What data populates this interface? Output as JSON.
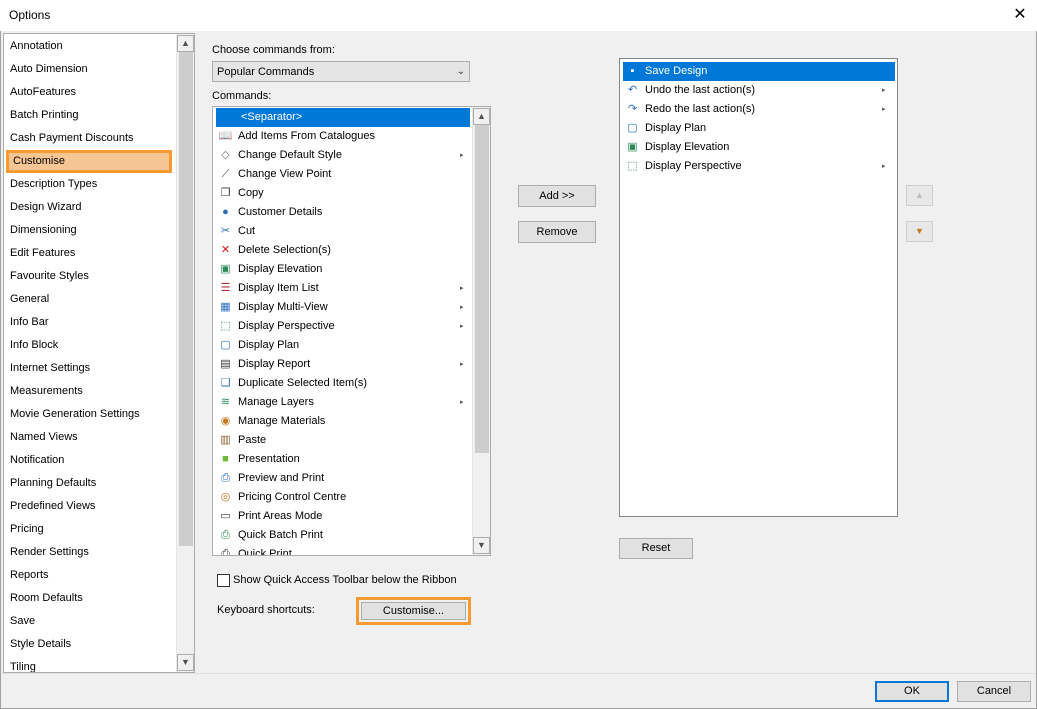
{
  "window": {
    "title": "Options",
    "close_glyph": "✕"
  },
  "categories": [
    "Annotation",
    "Auto Dimension",
    "AutoFeatures",
    "Batch Printing",
    "Cash Payment Discounts",
    "Customise",
    "Description Types",
    "Design Wizard",
    "Dimensioning",
    "Edit Features",
    "Favourite Styles",
    "General",
    "Info Bar",
    "Info Block",
    "Internet Settings",
    "Measurements",
    "Movie Generation Settings",
    "Named Views",
    "Notification",
    "Planning Defaults",
    "Predefined Views",
    "Pricing",
    "Render Settings",
    "Reports",
    "Room Defaults",
    "Save",
    "Style Details",
    "Tiling"
  ],
  "selected_category": "Customise",
  "choose_label": "Choose commands from:",
  "choose_value": "Popular Commands",
  "commands_label": "Commands:",
  "commands": [
    {
      "label": "<Separator>",
      "icon": "",
      "sub": false
    },
    {
      "label": "Add Items From Catalogues",
      "icon": "catalogue-icon",
      "sub": false
    },
    {
      "label": "Change Default Style",
      "icon": "style-icon",
      "sub": true
    },
    {
      "label": "Change View Point",
      "icon": "viewpoint-icon",
      "sub": false
    },
    {
      "label": "Copy",
      "icon": "copy-icon",
      "sub": false
    },
    {
      "label": "Customer Details",
      "icon": "customer-icon",
      "sub": false
    },
    {
      "label": "Cut",
      "icon": "cut-icon",
      "sub": false
    },
    {
      "label": "Delete Selection(s)",
      "icon": "delete-icon",
      "sub": false
    },
    {
      "label": "Display Elevation",
      "icon": "elevation-icon",
      "sub": false
    },
    {
      "label": "Display Item List",
      "icon": "item-list-icon",
      "sub": true
    },
    {
      "label": "Display Multi-View",
      "icon": "multi-view-icon",
      "sub": true
    },
    {
      "label": "Display Perspective",
      "icon": "perspective-icon",
      "sub": true
    },
    {
      "label": "Display Plan",
      "icon": "plan-icon",
      "sub": false
    },
    {
      "label": "Display Report",
      "icon": "report-icon",
      "sub": true
    },
    {
      "label": "Duplicate Selected Item(s)",
      "icon": "duplicate-icon",
      "sub": false
    },
    {
      "label": "Manage Layers",
      "icon": "layers-icon",
      "sub": true
    },
    {
      "label": "Manage Materials",
      "icon": "materials-icon",
      "sub": false
    },
    {
      "label": "Paste",
      "icon": "paste-icon",
      "sub": false
    },
    {
      "label": "Presentation",
      "icon": "presentation-icon",
      "sub": false
    },
    {
      "label": "Preview and Print",
      "icon": "preview-print-icon",
      "sub": false
    },
    {
      "label": "Pricing Control Centre",
      "icon": "pricing-icon",
      "sub": false
    },
    {
      "label": "Print Areas Mode",
      "icon": "print-areas-icon",
      "sub": false
    },
    {
      "label": "Quick Batch Print",
      "icon": "batch-print-icon",
      "sub": false
    },
    {
      "label": "Quick Print",
      "icon": "quick-print-icon",
      "sub": false
    }
  ],
  "add_label": "Add >>",
  "remove_label": "Remove",
  "toolbar_items": [
    {
      "label": "Save Design",
      "icon": "save-icon",
      "sub": false
    },
    {
      "label": "Undo the last action(s)",
      "icon": "undo-icon",
      "sub": true
    },
    {
      "label": "Redo the last action(s)",
      "icon": "redo-icon",
      "sub": true
    },
    {
      "label": "Display Plan",
      "icon": "plan-icon",
      "sub": false
    },
    {
      "label": "Display Elevation",
      "icon": "elevation-icon",
      "sub": false
    },
    {
      "label": "Display Perspective",
      "icon": "perspective-icon",
      "sub": true
    }
  ],
  "move_up_glyph": "▲",
  "move_down_glyph": "▼",
  "reset_label": "Reset",
  "show_qat_label": "Show Quick Access Toolbar below the Ribbon",
  "kbd_label": "Keyboard shortcuts:",
  "customise_label": "Customise...",
  "ok_label": "OK",
  "cancel_label": "Cancel",
  "scroll_up_glyph": "▲",
  "scroll_down_glyph": "▼",
  "chevron_glyph": "⌄",
  "submenu_glyph": "▸",
  "colors": {
    "selection": "#0078d7",
    "highlight_border": "#f59b32",
    "highlight_fill": "#f5c594"
  }
}
